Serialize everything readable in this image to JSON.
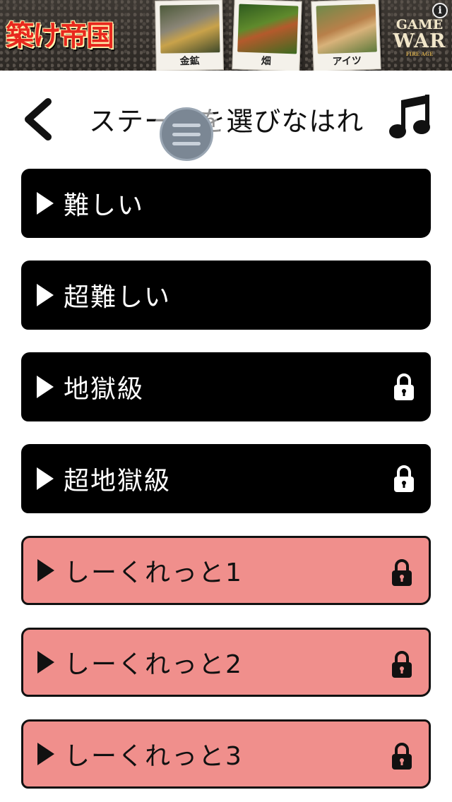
{
  "ad": {
    "title": "築け帝国",
    "photos": [
      "金鉱",
      "畑",
      "アイツ"
    ],
    "logo_line1": "GAME",
    "logo_line2": "WAR",
    "logo_line3": "FIRE AGE",
    "info_label": "i"
  },
  "header": {
    "title": "ステージを選びなはれ",
    "back_icon": "chevron-left-icon",
    "music_icon": "music-note-icon",
    "menu_icon": "hamburger-menu-icon"
  },
  "stages": [
    {
      "label": "難しい",
      "locked": false,
      "style": "black"
    },
    {
      "label": "超難しい",
      "locked": false,
      "style": "black"
    },
    {
      "label": "地獄級",
      "locked": true,
      "style": "black"
    },
    {
      "label": "超地獄級",
      "locked": true,
      "style": "black"
    },
    {
      "label": "しーくれっと1",
      "locked": true,
      "style": "pink"
    },
    {
      "label": "しーくれっと2",
      "locked": true,
      "style": "pink"
    },
    {
      "label": "しーくれっと3",
      "locked": true,
      "style": "pink"
    }
  ],
  "colors": {
    "black_button": "#000000",
    "secret_button": "#f08f8c",
    "background": "#ffffff"
  }
}
